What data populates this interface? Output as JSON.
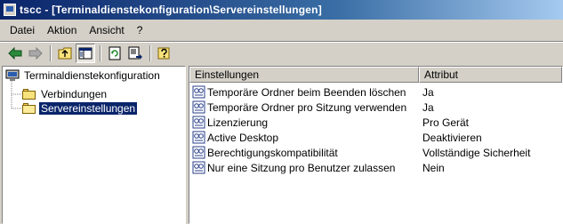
{
  "window": {
    "title": "tscc - [Terminaldienstekonfiguration\\Servereinstellungen]"
  },
  "menu": {
    "items": [
      "Datei",
      "Aktion",
      "Ansicht",
      "?"
    ]
  },
  "toolbar": {
    "buttons": [
      "back-arrow-icon",
      "forward-arrow-icon",
      "up-folder-icon",
      "show-hide-tree-icon",
      "refresh-icon",
      "export-list-icon",
      "help-icon"
    ]
  },
  "tree": {
    "root": "Terminaldienstekonfiguration",
    "children": [
      "Verbindungen",
      "Servereinstellungen"
    ],
    "selected": "Servereinstellungen"
  },
  "list": {
    "columns": [
      "Einstellungen",
      "Attribut"
    ],
    "rows": [
      {
        "name": "Temporäre Ordner beim Beenden löschen",
        "value": "Ja"
      },
      {
        "name": "Temporäre Ordner pro Sitzung verwenden",
        "value": "Ja"
      },
      {
        "name": "Lizenzierung",
        "value": "Pro Gerät"
      },
      {
        "name": "Active Desktop",
        "value": "Deaktivieren"
      },
      {
        "name": "Berechtigungskompatibilität",
        "value": "Vollständige Sicherheit"
      },
      {
        "name": "Nur eine Sitzung pro Benutzer zulassen",
        "value": "Nein"
      }
    ]
  },
  "colors": {
    "titlebar": "#0a246a",
    "selection": "#0a246a",
    "face": "#d4d0c8"
  }
}
